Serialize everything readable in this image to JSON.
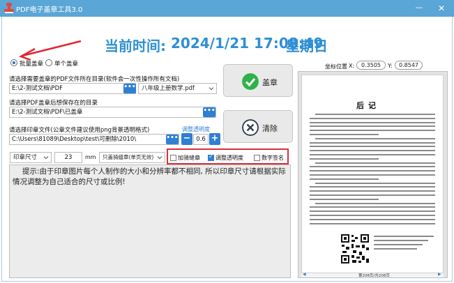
{
  "window": {
    "title": "PDF电子盖章工具3.0",
    "minimize": "—",
    "close": "✕"
  },
  "clock": {
    "label": "当前时间:",
    "datetime": "2024/1/21 17:08:49",
    "weekday": "星期日"
  },
  "mode": {
    "batch_label": "批量盖章",
    "single_label": "单个盖章",
    "selected": "batch"
  },
  "source": {
    "label": "请选择需要盖章的PDF文件所在目录(软件会一次性操作所有文档)",
    "path": "E:\\2-测试文档\\PDF",
    "browse": "•••",
    "file_select": "八年级上册数学.pdf"
  },
  "output": {
    "label": "请选择PDF盖章后想保存在的目录",
    "path": "E:\\2-测试文档\\PDF\\已盖章",
    "browse": "•••"
  },
  "stamp": {
    "label": "请选择印章文件(公章文件建议使用png背景透明格式)",
    "opacity_label": "调整透明度",
    "path": "C:\\Users\\81089\\Desktop\\test\\可删除\\2010\\",
    "browse": "•••",
    "minus": "−",
    "plus": "+",
    "opacity": "0.6"
  },
  "actions": {
    "stamp_label": "盖章",
    "clear_label": "清除"
  },
  "options": {
    "size_select": "印章尺寸",
    "size_value": "23",
    "size_unit": "mm",
    "mode_select": "只盖骑缝章(单页无效)",
    "cb_seam_label": "加骑缝章",
    "cb_seam_checked": false,
    "cb_opacity_label": "调整透明度",
    "cb_opacity_checked": true,
    "cb_sign_label": "数字签名",
    "cb_sign_checked": false
  },
  "hint": {
    "text": "提示:由于印章图片每个人制作的大小和分辨率都不相同, 所以印章尺寸请根据实际情况调整为自己适合的尺寸或比例!"
  },
  "preview": {
    "coord_label": "坐标位置",
    "x_label": "X:",
    "x_value": "0.3505",
    "y_label": "Y:",
    "y_value": "0.8547",
    "page_title": "后记",
    "page_indicator": "第208页/共208页",
    "prev": "◀",
    "next": "▶"
  },
  "colors": {
    "title_bar": "#5aa6d7",
    "accent": "#2f7fd2",
    "clock": "#2e8fd3",
    "highlight": "#d9303a",
    "stamp_icon": "#2fb24a",
    "clear_icon": "#2f3f55"
  }
}
